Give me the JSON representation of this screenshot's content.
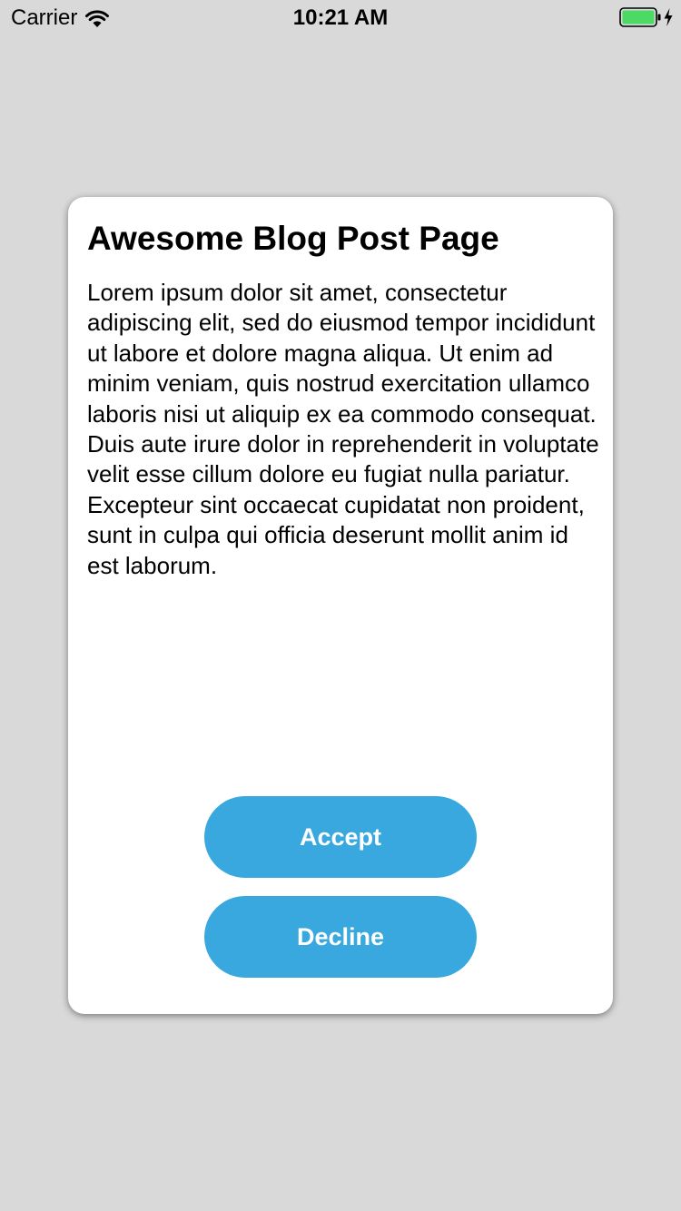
{
  "status_bar": {
    "carrier": "Carrier",
    "time": "10:21 AM",
    "battery_color": "#4cd964"
  },
  "card": {
    "title": "Awesome Blog Post Page",
    "body": "Lorem ipsum dolor sit amet, consectetur adipiscing elit, sed do eiusmod tempor incididunt ut labore et dolore magna aliqua. Ut enim ad minim veniam, quis nostrud exercitation ullamco laboris nisi ut aliquip ex ea commodo consequat. Duis aute irure dolor in reprehenderit in voluptate velit esse cillum dolore eu fugiat nulla pariatur. Excepteur sint occaecat cupidatat non proident, sunt in culpa qui officia deserunt mollit anim id est laborum.",
    "accept_label": "Accept",
    "decline_label": "Decline",
    "button_color": "#38a8df"
  },
  "icons": {
    "wifi": "wifi-icon",
    "battery": "battery-icon",
    "charging": "bolt-icon"
  }
}
